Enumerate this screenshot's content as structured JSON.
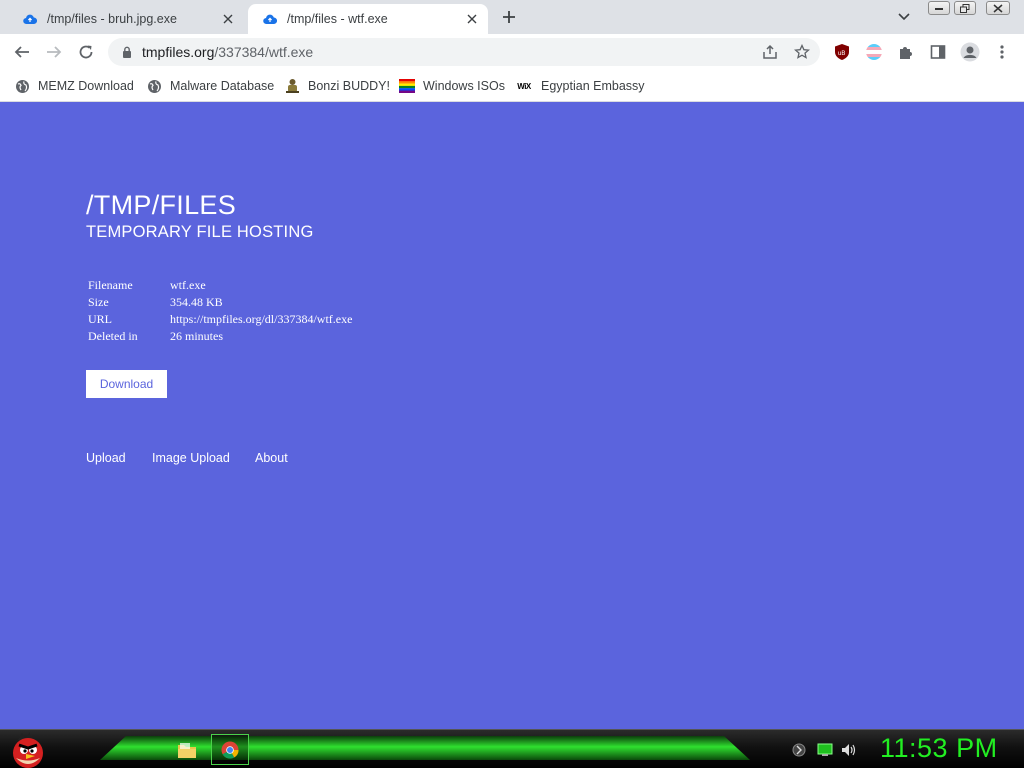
{
  "browser": {
    "tabs": [
      {
        "title": "/tmp/files - bruh.jpg.exe",
        "active": false,
        "icon": "cloud-upload-icon"
      },
      {
        "title": "/tmp/files - wtf.exe",
        "active": true,
        "icon": "cloud-upload-icon"
      }
    ],
    "address": {
      "domain": "tmpfiles.org",
      "path": "/337384/wtf.exe"
    },
    "bookmarks": [
      {
        "label": "MEMZ Download",
        "icon": "globe-icon"
      },
      {
        "label": "Malware Database",
        "icon": "globe-icon"
      },
      {
        "label": "Bonzi BUDDY!",
        "icon": "bonzi-icon"
      },
      {
        "label": "Windows ISOs",
        "icon": "rainbow-flag-icon"
      },
      {
        "label": "Egyptian Embassy",
        "icon": "wix-icon",
        "icon_text": "WiX"
      }
    ]
  },
  "page": {
    "title": "/TMP/FILES",
    "subtitle": "TEMPORARY FILE HOSTING",
    "file_info": [
      {
        "key": "Filename",
        "value": "wtf.exe"
      },
      {
        "key": "Size",
        "value": "354.48 KB"
      },
      {
        "key": "URL",
        "value": "https://tmpfiles.org/dl/337384/wtf.exe"
      },
      {
        "key": "Deleted in",
        "value": "26 minutes"
      }
    ],
    "download_label": "Download",
    "footer_links": [
      "Upload",
      "Image Upload",
      "About"
    ]
  },
  "taskbar": {
    "clock": "11:53 PM"
  },
  "colors": {
    "page_background": "#5b64dd",
    "clock": "#22ee22",
    "taskbar_glow": "#2fe02f"
  }
}
